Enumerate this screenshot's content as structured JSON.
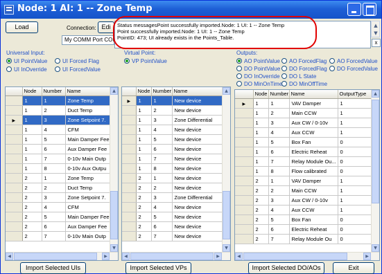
{
  "window": {
    "title": "Node: 1 AI: 1 -- Zone Temp"
  },
  "toolbar": {
    "load_label": "Load",
    "connection_label": "Connection:",
    "edit_label": "Edi",
    "connection_value": "My COMM Port COM3"
  },
  "status": {
    "lines": [
      "Status messagesPoint successfully imported.Node: 1 UI: 1 -- Zone Temp",
      "Point successfully imported.Node: 1 UI: 1 -- Zone Temp",
      "PointID: 473; UI already exists in the Points_Table."
    ],
    "close_label": "x"
  },
  "universal_input": {
    "label": "Universal Input:",
    "options": [
      {
        "label": "UI PointValue",
        "selected": true
      },
      {
        "label": "UI Forced Flag",
        "selected": false
      },
      {
        "label": "UI InOverride",
        "selected": false
      },
      {
        "label": "UI ForcedValue",
        "selected": false
      }
    ]
  },
  "virtual_point": {
    "label": "Virtual Point:",
    "options": [
      {
        "label": "VP PointValue",
        "selected": true
      }
    ]
  },
  "outputs": {
    "label": "Outputs:",
    "options": [
      {
        "label": "AO PointValue",
        "selected": true
      },
      {
        "label": "AO ForcedFlag",
        "selected": false
      },
      {
        "label": "AO ForcedValue",
        "selected": false
      },
      {
        "label": "DO PointValue",
        "selected": false
      },
      {
        "label": "DO ForcedFlag",
        "selected": false
      },
      {
        "label": "DO ForcedValue",
        "selected": false
      },
      {
        "label": "DO InOverride",
        "selected": false
      },
      {
        "label": "DO L State",
        "selected": false
      },
      {
        "label": "DO MinOnTime",
        "selected": false
      },
      {
        "label": "DO MinOffTime",
        "selected": false
      }
    ]
  },
  "ui_grid": {
    "columns": [
      "Node",
      "Number",
      "Name"
    ],
    "rows": [
      [
        "1",
        "1",
        "Zone Temp"
      ],
      [
        "1",
        "2",
        "Duct Temp"
      ],
      [
        "1",
        "3",
        "Zone Setpoint 7."
      ],
      [
        "1",
        "4",
        "CFM"
      ],
      [
        "1",
        "5",
        "Main Damper Fee"
      ],
      [
        "1",
        "6",
        "Aux Damper Fee"
      ],
      [
        "1",
        "7",
        "0-10v Main Outp"
      ],
      [
        "1",
        "8",
        "0-10v Aux Outpu"
      ],
      [
        "2",
        "1",
        "Zone Temp"
      ],
      [
        "2",
        "2",
        "Duct Temp"
      ],
      [
        "2",
        "3",
        "Zone Setpoint 7."
      ],
      [
        "2",
        "4",
        "CFM"
      ],
      [
        "2",
        "5",
        "Main Damper Fee"
      ],
      [
        "2",
        "6",
        "Aux Damper Fee"
      ],
      [
        "2",
        "7",
        "0-10v Main Outp"
      ]
    ],
    "import_label": "Import Selected UIs"
  },
  "vp_grid": {
    "columns": [
      "Node",
      "Number",
      "Name"
    ],
    "rows": [
      [
        "1",
        "1",
        "New device"
      ],
      [
        "1",
        "2",
        "New device"
      ],
      [
        "1",
        "3",
        "Zone Differential"
      ],
      [
        "1",
        "4",
        "New device"
      ],
      [
        "1",
        "5",
        "New device"
      ],
      [
        "1",
        "6",
        "New device"
      ],
      [
        "1",
        "7",
        "New device"
      ],
      [
        "1",
        "8",
        "New device"
      ],
      [
        "2",
        "1",
        "New device"
      ],
      [
        "2",
        "2",
        "New device"
      ],
      [
        "2",
        "3",
        "Zone Differential"
      ],
      [
        "2",
        "4",
        "New device"
      ],
      [
        "2",
        "5",
        "New device"
      ],
      [
        "2",
        "6",
        "New device"
      ],
      [
        "2",
        "7",
        "New device"
      ]
    ],
    "import_label": "Import Selected VPs"
  },
  "out_grid": {
    "columns": [
      "Node",
      "Number",
      "Name",
      "OutputType"
    ],
    "rows": [
      [
        "1",
        "1",
        "VAV Damper",
        "1"
      ],
      [
        "1",
        "2",
        "Main CCW",
        "1"
      ],
      [
        "1",
        "3",
        "Aux CW / 0-10v",
        "1"
      ],
      [
        "1",
        "4",
        "Aux CCW",
        "1"
      ],
      [
        "1",
        "5",
        "Box Fan",
        "0"
      ],
      [
        "1",
        "6",
        "Electric Reheat",
        "0"
      ],
      [
        "1",
        "7",
        "Relay Module Ou...",
        "0"
      ],
      [
        "1",
        "8",
        "Flow calibrated",
        "0"
      ],
      [
        "2",
        "1",
        "VAV Damper",
        "1"
      ],
      [
        "2",
        "2",
        "Main CCW",
        "1"
      ],
      [
        "2",
        "3",
        "Aux CW / 0-10v",
        "1"
      ],
      [
        "2",
        "4",
        "Aux CCW",
        "1"
      ],
      [
        "2",
        "5",
        "Box Fan",
        "0"
      ],
      [
        "2",
        "6",
        "Electric Reheat",
        "0"
      ],
      [
        "2",
        "7",
        "Relay Module Ou",
        "0"
      ]
    ],
    "import_label": "Import Selected DO/AOs"
  },
  "footer": {
    "exit_label": "Exit"
  }
}
